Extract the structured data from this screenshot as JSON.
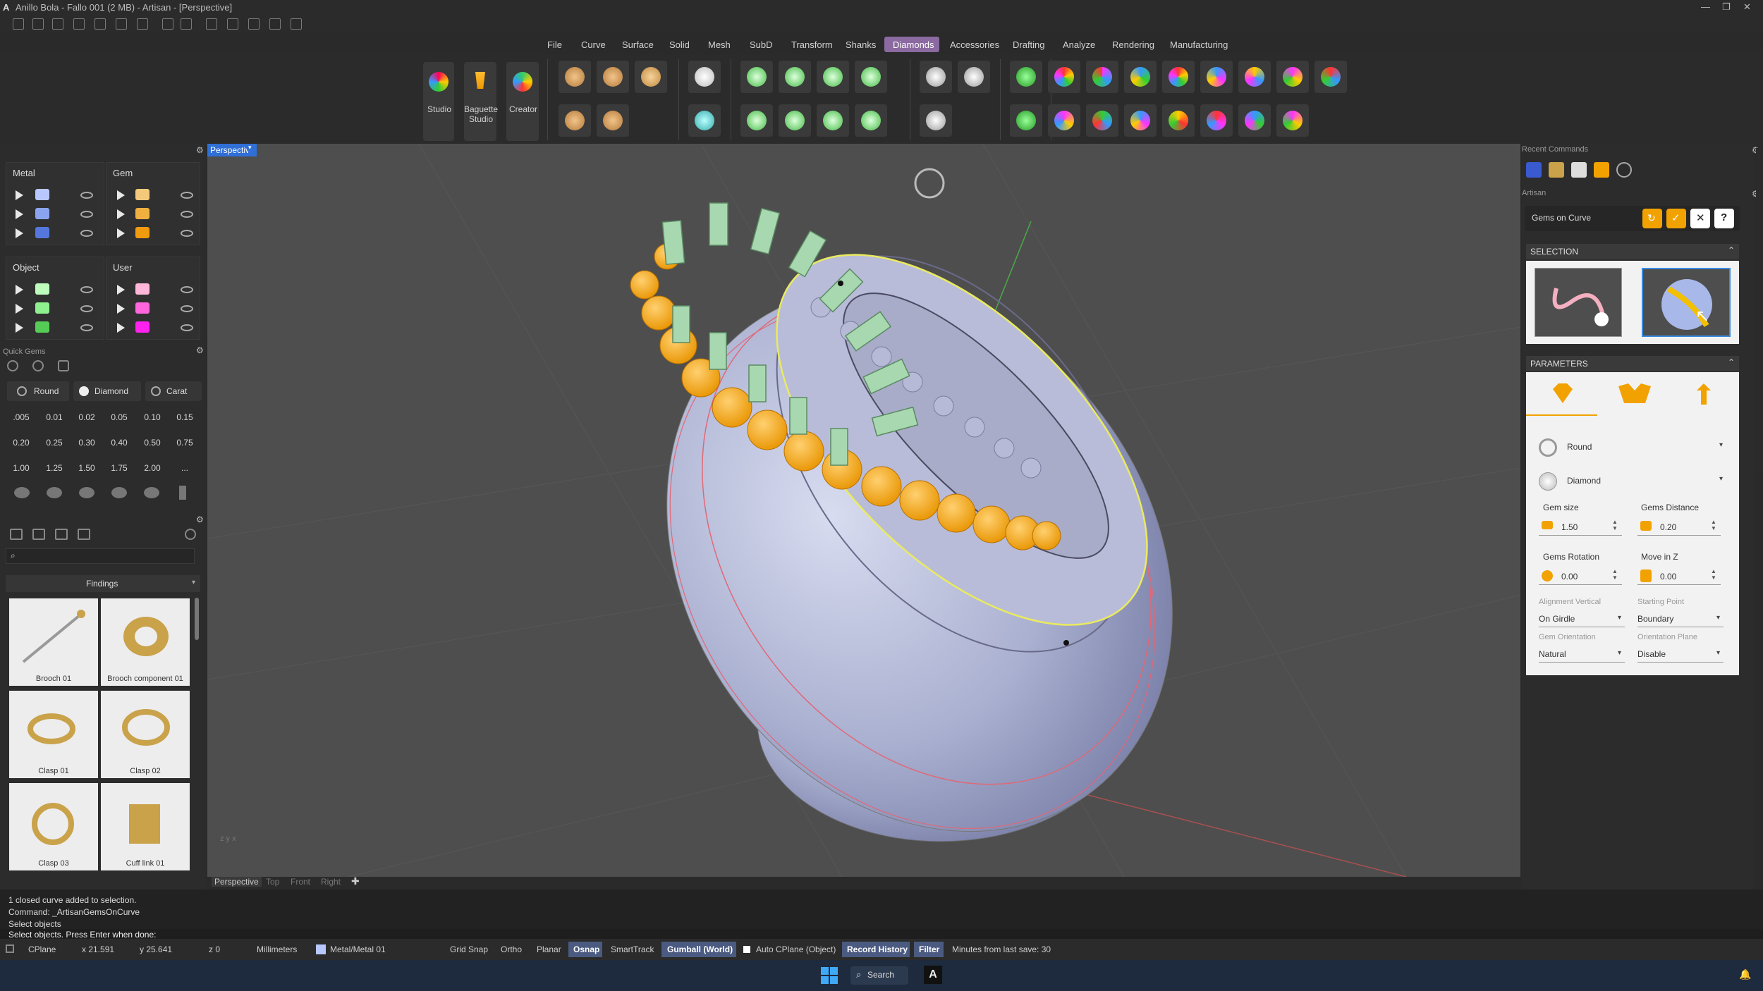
{
  "app": {
    "title": "Anillo Bola - Fallo 001 (2 MB) - Artisan - [Perspective]"
  },
  "menu": [
    "File",
    "Curve",
    "Surface",
    "Solid",
    "Mesh",
    "SubD",
    "Transform",
    "Shanks",
    "Diamonds",
    "Accessories",
    "Drafting",
    "Analyze",
    "Rendering",
    "Manufacturing"
  ],
  "menu_active": "Diamonds",
  "ribbon": {
    "studio": "Studio",
    "baguette_studio": "Baguette Studio",
    "creator": "Creator"
  },
  "layers": {
    "metal": "Metal",
    "gem": "Gem",
    "object": "Object",
    "user": "User"
  },
  "quick_gems": {
    "title": "Quick Gems",
    "shape": "Round",
    "material": "Diamond",
    "unit": "Carat",
    "values": [
      ".005",
      "0.01",
      "0.02",
      "0.05",
      "0.10",
      "0.15",
      "0.20",
      "0.25",
      "0.30",
      "0.40",
      "0.50",
      "0.75",
      "1.00",
      "1.25",
      "1.50",
      "1.75",
      "2.00",
      "..."
    ]
  },
  "library": {
    "category": "Findings",
    "items": [
      "Brooch 01",
      "Brooch component 01",
      "Clasp 01",
      "Clasp 02",
      "Clasp 03",
      "Cuff link 01"
    ]
  },
  "viewport": {
    "active": "Perspective",
    "tabs": [
      "Perspective",
      "Top",
      "Front",
      "Right"
    ]
  },
  "right": {
    "recent_commands": "Recent Commands",
    "artisan": "Artisan",
    "command": "Gems on Curve",
    "selection": "SELECTION",
    "parameters": "PARAMETERS",
    "shape": "Round",
    "material": "Diamond",
    "gem_size_label": "Gem size",
    "gem_size": "1.50",
    "gems_distance_label": "Gems Distance",
    "gems_distance": "0.20",
    "gems_rotation_label": "Gems Rotation",
    "gems_rotation": "0.00",
    "move_z_label": "Move in Z",
    "move_z": "0.00",
    "alignment_label": "Alignment Vertical",
    "alignment": "On Girdle",
    "starting_label": "Starting Point",
    "starting": "Boundary",
    "orientation_label": "Gem Orientation",
    "orientation": "Natural",
    "plane_label": "Orientation Plane",
    "plane": "Disable"
  },
  "command_line": {
    "line1": "1 closed curve added to selection.",
    "line2": "Command: _ArtisanGemsOnCurve",
    "line3": "Select objects",
    "prompt": "Select objects. Press Enter when done:"
  },
  "status": {
    "cplane": "CPlane",
    "x": "x 21.591",
    "y": "y 25.641",
    "z": "z 0",
    "units": "Millimeters",
    "layer": "Metal/Metal 01",
    "grid_snap": "Grid Snap",
    "ortho": "Ortho",
    "planar": "Planar",
    "osnap": "Osnap",
    "smarttrack": "SmartTrack",
    "gumball": "Gumball (World)",
    "auto_cplane": "Auto CPlane (Object)",
    "record_history": "Record History",
    "filter": "Filter",
    "minutes": "Minutes from last save: 30"
  },
  "taskbar": {
    "search": "Search"
  },
  "colors": {
    "accent_orange": "#f2a200",
    "active_blue": "#2f6fd6",
    "metal_swatches": [
      "#b9c7ff",
      "#8aa4f0",
      "#5577dd"
    ],
    "gem_swatches": [
      "#f4c97a",
      "#f0b040",
      "#f09a10"
    ],
    "object_swatches": [
      "#bdfcbd",
      "#8ef08e",
      "#55cc55"
    ],
    "user_swatches": [
      "#ffb6d9",
      "#ff66dd",
      "#ff22ee"
    ]
  }
}
